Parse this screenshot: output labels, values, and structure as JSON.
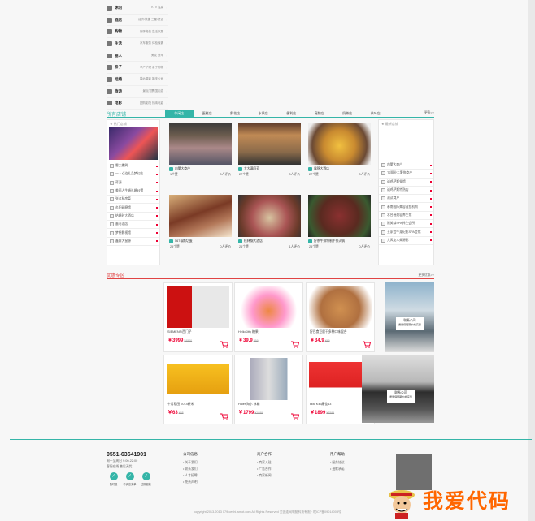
{
  "categories": [
    {
      "name": "休闲",
      "sub": "KTV  温泉"
    },
    {
      "name": "酒店",
      "sub": "经济/快捷  三星/舒适"
    },
    {
      "name": "购物",
      "sub": "服饰鞋包  生活家居"
    },
    {
      "name": "生活",
      "sub": "汽车服务  体检保健"
    },
    {
      "name": "丽人",
      "sub": "美发  美甲"
    },
    {
      "name": "亲子",
      "sub": "孕产护理  亲子购物"
    },
    {
      "name": "结婚",
      "sub": "婚纱摄影  婚庆公司"
    },
    {
      "name": "旅游",
      "sub": "景点门票  国内游"
    },
    {
      "name": "电影",
      "sub": "团购影院  热映电影"
    }
  ],
  "stores": {
    "title": "所有店铺",
    "more": "更多>>",
    "tabs": [
      "休闲店",
      "蛋糕店",
      "鲜花店",
      "水果店",
      "便利店",
      "宠物店",
      "奶茶店",
      "茶叶店"
    ],
    "left_panel_head": "★ 热门店铺",
    "right_panel_head": "★ 最新店铺",
    "hot_list": [
      "雪大撒刷",
      "一人心涟礼品梦幻店",
      "蒋源",
      "美丽人生婚礼婚纱馆",
      "张点私房菜",
      "炎阳研磨馆",
      "结婚时大酒店",
      "墨马酒店",
      "梦想影视馆",
      "鑫炸大鼠源"
    ],
    "new_list": [
      "内蒙大商户",
      "T2翔业二奢侈商户",
      "诚鸡萨斯餐馆",
      "诚鸡萨斯特熟店",
      "测试商户",
      "春南国际美容连锁机构",
      "水台瑶美容养生馆",
      "隆美尊SPA养生会所",
      "王家会午身纪影SPA会馆",
      "大风友人美源影"
    ],
    "cards": [
      {
        "name": "内蒙大商户",
        "likes": "1个赞",
        "reviews": "0人评价"
      },
      {
        "name": "大大满庭芳",
        "likes": "27个赞",
        "reviews": "0人评价"
      },
      {
        "name": "露锦大酒店",
        "likes": "27个赞",
        "reviews": "0人评价"
      },
      {
        "name": "567幕斯切蛋",
        "likes": "25个赞",
        "reviews": "0人评价"
      },
      {
        "name": "桂林钢大酒店",
        "likes": "26个赞",
        "reviews": "1人评价"
      },
      {
        "name": "好茶牛排特制牛排火锅",
        "likes": "25个赞",
        "reviews": "0人评价"
      }
    ]
  },
  "promo": {
    "title": "优惠专区",
    "more": "更多优惠>>",
    "products": [
      {
        "name": "SIEMENS/西门子",
        "price": "￥3999",
        "old": "¥4500"
      },
      {
        "name": "HelloKitty 糖果",
        "price": "￥39.9",
        "old": "¥69"
      },
      {
        "name": "好巴食豆腐干多种口味混合",
        "price": "￥34.9",
        "old": "¥49"
      },
      {
        "name": "十月稻田 2014新米",
        "price": "￥63",
        "old": "¥88"
      },
      {
        "name": "Haier/海尔 冰箱",
        "price": "￥1799",
        "old": "¥1999"
      },
      {
        "name": "kktv K43康佳43",
        "price": "￥1899",
        "old": "¥2599"
      }
    ],
    "side_texts": [
      "联系公司",
      "质量保障期 价格实惠"
    ]
  },
  "footer": {
    "phone": "0551-63641901",
    "hours": "周一至周日 9:00-22:00",
    "slogan": "客服在线 售后无忧",
    "badges": [
      "随时退",
      "不满意免单",
      "过期退款"
    ],
    "cols": [
      {
        "title": "公司信息",
        "links": [
          "关于我们",
          "联系我们",
          "人才招聘",
          "免责声明"
        ]
      },
      {
        "title": "商户合作",
        "links": [
          "商家入驻",
          "广告合作",
          "商家新闻"
        ]
      },
      {
        "title": "用户帮助",
        "links": [
          "服务协议",
          "退款承诺"
        ]
      }
    ],
    "copyright": "copyright 2013-2013 079.ceshi.wmot.com All Rights Reserved 全国连网电脑科技有限 · 皖ICP备09014003号",
    "watermark": "我爱代码"
  },
  "colors": {
    "accent": "#35b5a8",
    "promo": "#e04343",
    "price": "#ee0033"
  }
}
